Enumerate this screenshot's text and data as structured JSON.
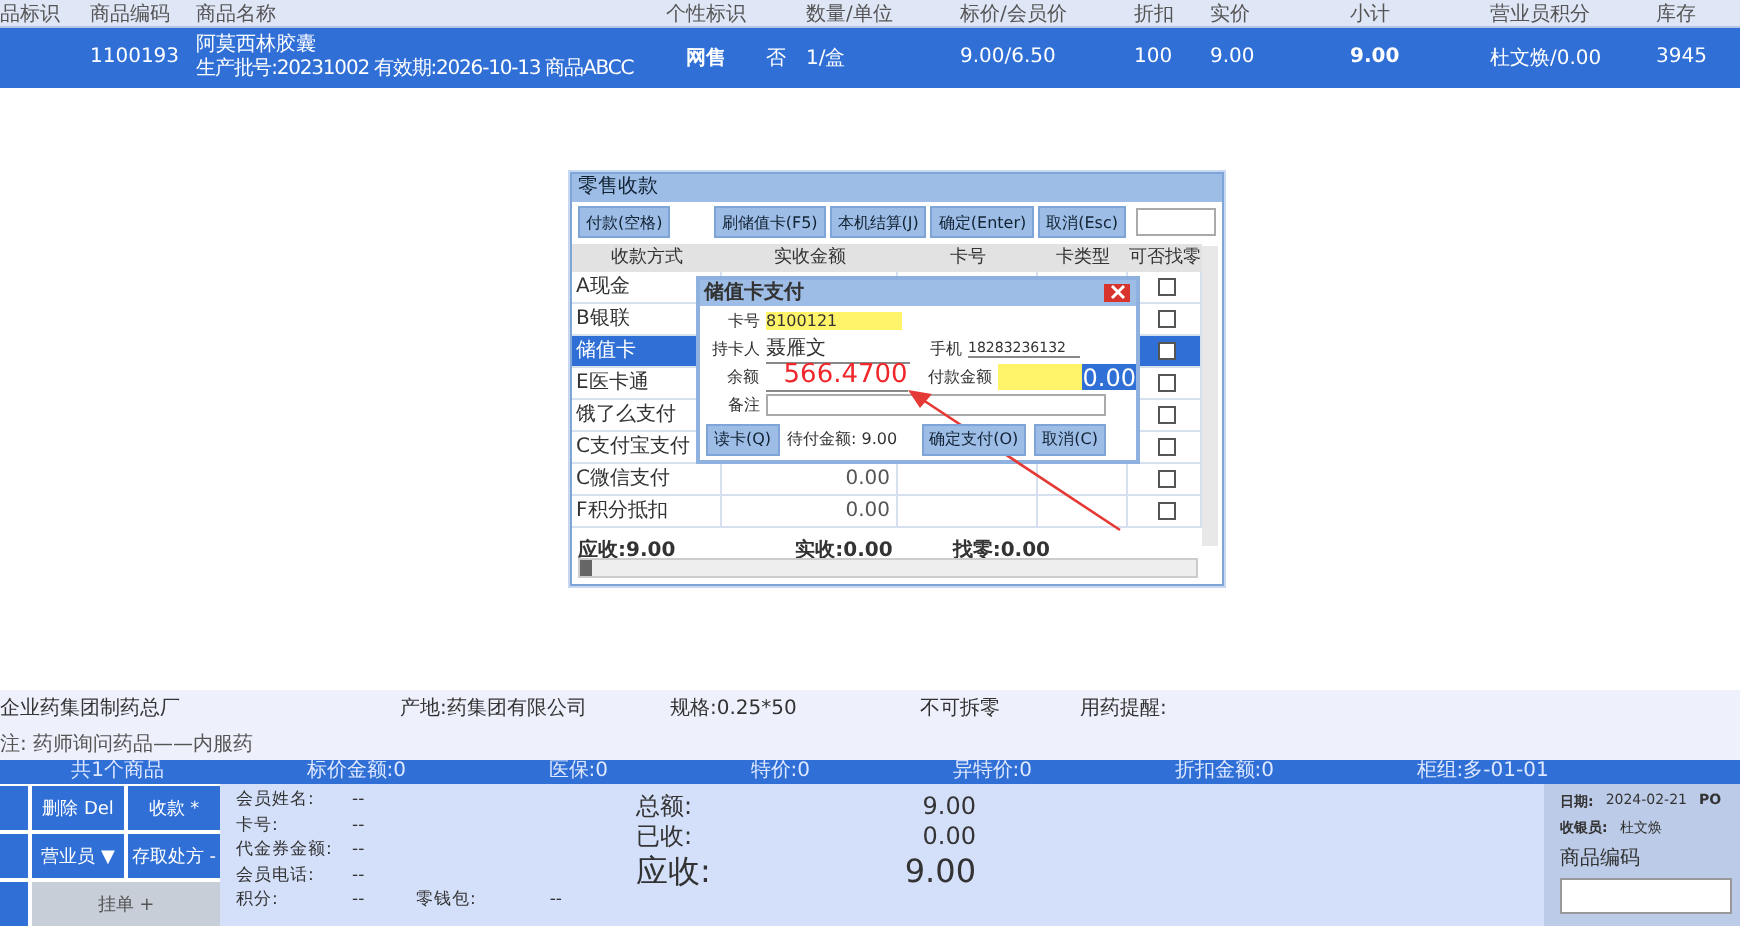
{
  "table": {
    "columns": [
      "品标识",
      "商品编码",
      "商品名称",
      "个性标识",
      "数量/单位",
      "标价/会员价",
      "折扣",
      "实价",
      "小计",
      "营业员积分",
      "库存"
    ],
    "rows": [
      {
        "selected": true,
        "code": "1100193",
        "name": "阿莫西林胶囊",
        "detail": "生产批号:20231002 有效期:2026-10-13 商品ABCC",
        "tag": "网售",
        "flag": "否",
        "qty": "1/盒",
        "price": "9.00/6.50",
        "discount": "100",
        "actual": "9.00",
        "subtotal": "9.00",
        "clerk": "杜文焕/0.00",
        "stock": "3945"
      }
    ]
  },
  "dialog": {
    "title": "零售收款",
    "buttons": [
      {
        "label": "付款(空格)"
      },
      {
        "label": "刷储值卡(F5)"
      },
      {
        "label": "本机结算(J)"
      },
      {
        "label": "确定(Enter)"
      },
      {
        "label": "取消(Esc)"
      }
    ],
    "columns": [
      "收款方式",
      "实收金额",
      "卡号",
      "卡类型",
      "可否找零"
    ],
    "rows": [
      {
        "method": "A现金",
        "amount": "",
        "selected": false,
        "checked": false
      },
      {
        "method": "B银联",
        "amount": "",
        "selected": false,
        "checked": false
      },
      {
        "method": "储值卡",
        "amount": "",
        "selected": true,
        "checked": false
      },
      {
        "method": "E医卡通",
        "amount": "",
        "selected": false,
        "checked": false
      },
      {
        "method": "饿了么支付",
        "amount": "",
        "selected": false,
        "checked": false
      },
      {
        "method": "C支付宝支付",
        "amount": "",
        "selected": false,
        "checked": false
      },
      {
        "method": "C微信支付",
        "amount": "0.00",
        "selected": false,
        "checked": false
      },
      {
        "method": "F积分抵扣",
        "amount": "0.00",
        "selected": false,
        "checked": false
      }
    ],
    "footer": [
      "应收:9.00",
      "实收:0.00",
      "找零:0.00"
    ]
  },
  "card_dialog": {
    "title": "储值卡支付",
    "card_label": "卡号",
    "card_no": "8100121",
    "holder_label": "持卡人",
    "holder": "聂雁文",
    "phone_label": "手机",
    "phone": "18283236132",
    "balance_label": "余额",
    "balance": "566.4700",
    "pay_label": "付款金额",
    "pay_amount": "0.00",
    "note_label": "备注",
    "read_button": "读卡(Q)",
    "pending": "待付金额: 9.00",
    "confirm_button": "确定支付(O)",
    "cancel_button": "取消(C)"
  },
  "info": {
    "line1": [
      "企业药集团制药总厂",
      "产地:药集团有限公司",
      "规格:0.25*50",
      "不可拆零",
      "用药提醒:"
    ],
    "line2": "注: 药师询问药品——内服药"
  },
  "summary_bar": [
    "共1个商品",
    "标价金额:0",
    "医保:0",
    "特价:0",
    "异特价:0",
    "折扣金额:0",
    "柜组:多-01-01"
  ],
  "actions": [
    {
      "kind": "cut"
    },
    {
      "label": "删除 Del",
      "kind": "normal"
    },
    {
      "label": "收款 *",
      "kind": "normal"
    },
    {
      "kind": "cut"
    },
    {
      "label": "营业员 ▼",
      "kind": "normal"
    },
    {
      "label": "存取处方 -",
      "kind": "normal"
    },
    {
      "kind": "cut"
    },
    {
      "label": "挂单 +",
      "kind": "wide"
    }
  ],
  "member": [
    {
      "label": "会员姓名:",
      "value": "--"
    },
    {
      "label": "卡号:",
      "value": "--"
    },
    {
      "label": "代金券金额:",
      "value": "--"
    },
    {
      "label": "会员电话:",
      "value": "--"
    },
    {
      "label": "积分:",
      "value": "--"
    },
    {
      "label": "零钱包:",
      "value": "--"
    }
  ],
  "totals": [
    {
      "label": "总额:",
      "value": "9.00",
      "kind": "normal"
    },
    {
      "label": "已收:",
      "value": "0.00",
      "kind": "normal"
    },
    {
      "label": "应收:",
      "value": "9.00",
      "kind": "big"
    }
  ],
  "side": {
    "date_label": "日期:",
    "date": "2024-02-21",
    "pos": "PO",
    "cashier_label": "收银员:",
    "cashier": "杜文焕",
    "code_label": "商品编码"
  }
}
